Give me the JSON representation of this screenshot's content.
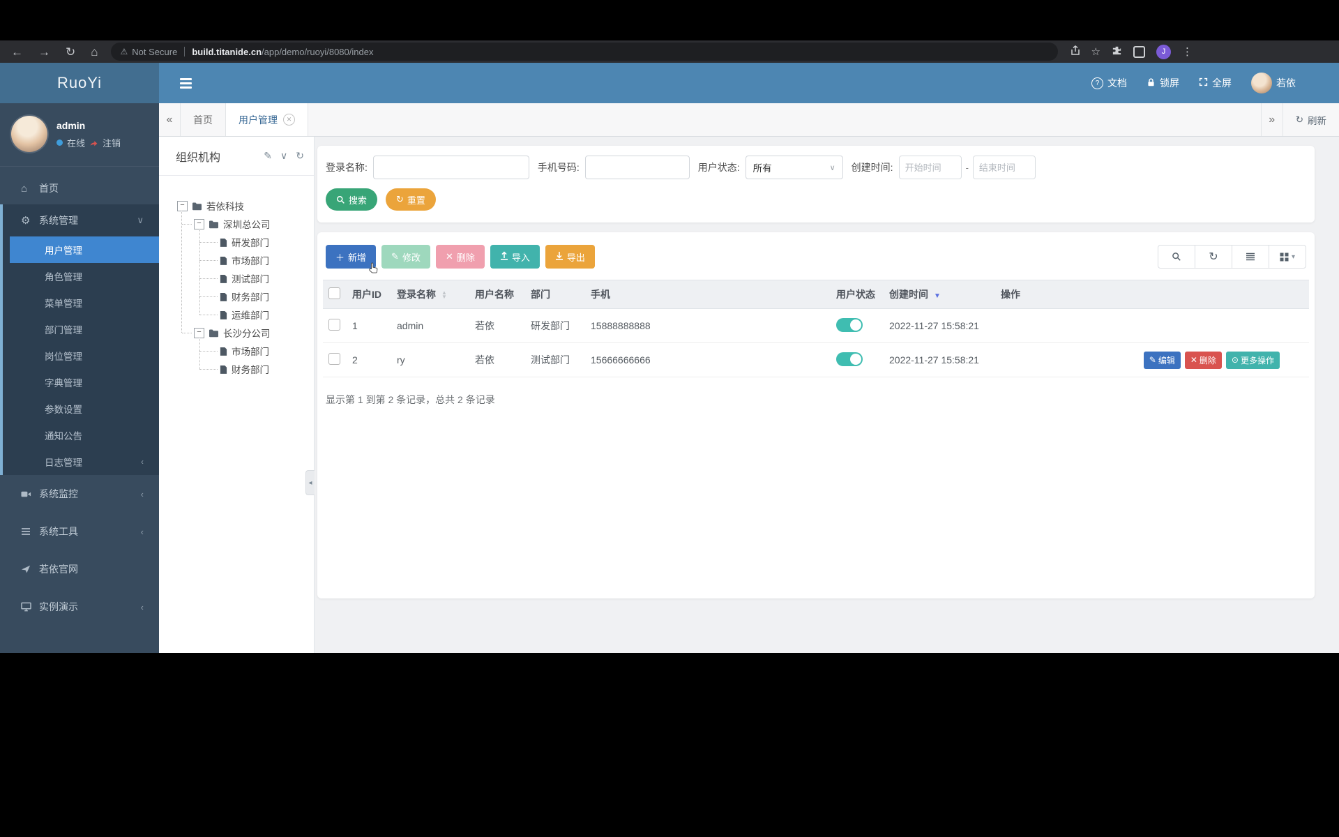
{
  "browser": {
    "warning_label": "Not Secure",
    "url_host": "build.titanide.cn",
    "url_path": "/app/demo/ruoyi/8080/index",
    "profile_initial": "J"
  },
  "header": {
    "brand": "RuoYi",
    "actions": [
      {
        "key": "docs",
        "icon": "question-circle-icon",
        "label": "文档"
      },
      {
        "key": "lock-screen",
        "icon": "lock-icon",
        "label": "锁屏"
      },
      {
        "key": "fullscreen",
        "icon": "fullscreen-icon",
        "label": "全屏"
      },
      {
        "key": "current-user",
        "icon": "avatar",
        "label": "若依"
      }
    ]
  },
  "sidebar": {
    "user": {
      "name": "admin",
      "status": "在线",
      "logout": "注销"
    },
    "menu": [
      {
        "key": "home",
        "icon": "home-icon",
        "label": "首页"
      },
      {
        "key": "system-manage",
        "icon": "gear-icon",
        "label": "系统管理",
        "chevron": "down",
        "expanded": true,
        "children": [
          {
            "key": "user-manage",
            "label": "用户管理",
            "active": true
          },
          {
            "key": "role-manage",
            "label": "角色管理"
          },
          {
            "key": "menu-manage",
            "label": "菜单管理"
          },
          {
            "key": "dept-manage",
            "label": "部门管理"
          },
          {
            "key": "post-manage",
            "label": "岗位管理"
          },
          {
            "key": "dict-manage",
            "label": "字典管理"
          },
          {
            "key": "param-config",
            "label": "参数设置"
          },
          {
            "key": "notice",
            "label": "通知公告"
          },
          {
            "key": "log-manage",
            "label": "日志管理",
            "chevron": "left"
          }
        ]
      },
      {
        "key": "system-monitor",
        "icon": "camera-icon",
        "label": "系统监控",
        "chevron": "left"
      },
      {
        "key": "system-tools",
        "icon": "tools-icon",
        "label": "系统工具",
        "chevron": "left"
      },
      {
        "key": "ruoyi-site",
        "icon": "paper-plane-icon",
        "label": "若依官网"
      },
      {
        "key": "demo",
        "icon": "desktop-icon",
        "label": "实例演示",
        "chevron": "left"
      }
    ]
  },
  "tabs": {
    "items": [
      {
        "key": "home",
        "label": "首页",
        "active": false,
        "closable": false
      },
      {
        "key": "user-manage",
        "label": "用户管理",
        "active": true,
        "closable": true
      }
    ],
    "refresh_label": "刷新"
  },
  "org_tree": {
    "title": "组织机构",
    "nodes": [
      {
        "label": "若依科技",
        "type": "folder",
        "level": 0,
        "expander": true
      },
      {
        "label": "深圳总公司",
        "type": "folder",
        "level": 1,
        "expander": true
      },
      {
        "label": "研发部门",
        "type": "file",
        "level": 2
      },
      {
        "label": "市场部门",
        "type": "file",
        "level": 2
      },
      {
        "label": "测试部门",
        "type": "file",
        "level": 2
      },
      {
        "label": "财务部门",
        "type": "file",
        "level": 2
      },
      {
        "label": "运维部门",
        "type": "file",
        "level": 2
      },
      {
        "label": "长沙分公司",
        "type": "folder",
        "level": 1,
        "expander": true
      },
      {
        "label": "市场部门",
        "type": "file",
        "level": 2
      },
      {
        "label": "财务部门",
        "type": "file",
        "level": 2
      }
    ]
  },
  "search": {
    "login_label": "登录名称:",
    "phone_label": "手机号码:",
    "status_label": "用户状态:",
    "status_value": "所有",
    "created_label": "创建时间:",
    "start_placeholder": "开始时间",
    "range_separator": "-",
    "end_placeholder": "结束时间",
    "search_button": "搜索",
    "reset_button": "重置"
  },
  "toolbar": {
    "buttons": [
      {
        "key": "add",
        "label": "新增",
        "icon": "plus-icon",
        "style": "primary"
      },
      {
        "key": "edit",
        "label": "修改",
        "icon": "edit-icon",
        "style": "success-disabled"
      },
      {
        "key": "delete",
        "label": "删除",
        "icon": "close-icon",
        "style": "danger-disabled"
      },
      {
        "key": "import",
        "label": "导入",
        "icon": "upload-icon",
        "style": "info"
      },
      {
        "key": "export",
        "label": "导出",
        "icon": "download-icon",
        "style": "warning"
      }
    ],
    "right_icons": [
      "search-icon",
      "refresh-icon",
      "columns-icon",
      "grid-icon"
    ]
  },
  "table": {
    "columns": [
      {
        "key": "checkbox",
        "label": "",
        "type": "checkbox"
      },
      {
        "key": "id",
        "label": "用户ID"
      },
      {
        "key": "login",
        "label": "登录名称",
        "sortable": true
      },
      {
        "key": "name",
        "label": "用户名称"
      },
      {
        "key": "dept",
        "label": "部门"
      },
      {
        "key": "phone",
        "label": "手机"
      },
      {
        "key": "status",
        "label": "用户状态"
      },
      {
        "key": "created",
        "label": "创建时间",
        "sorted": "desc"
      },
      {
        "key": "actions",
        "label": "操作"
      }
    ],
    "rows": [
      {
        "id": "1",
        "login": "admin",
        "name": "若依",
        "dept": "研发部门",
        "phone": "15888888888",
        "status_on": true,
        "created": "2022-11-27 15:58:21",
        "actions": []
      },
      {
        "id": "2",
        "login": "ry",
        "name": "若依",
        "dept": "测试部门",
        "phone": "15666666666",
        "status_on": true,
        "created": "2022-11-27 15:58:21",
        "actions": [
          {
            "key": "edit",
            "label": "编辑",
            "icon": "edit-icon",
            "style": "primary"
          },
          {
            "key": "delete",
            "label": "删除",
            "icon": "close-icon",
            "style": "danger"
          },
          {
            "key": "more",
            "label": "更多操作",
            "icon": "more-icon",
            "style": "info"
          }
        ]
      }
    ],
    "summary": "显示第 1 到第 2 条记录，总共 2 条记录"
  },
  "colors": {
    "header_blue": "#4d86b2",
    "logo_blue": "#426e90",
    "sidebar_dark": "#384b5e",
    "active_menu_blue": "#3f86d0",
    "primary_button": "#3c72c0",
    "success_green": "#38a577",
    "warning_orange": "#eba43b",
    "info_teal": "#41b3ac",
    "danger_red": "#d9534f",
    "toggle_on": "#3fbdb1",
    "sort_active": "#5a6fe0"
  }
}
